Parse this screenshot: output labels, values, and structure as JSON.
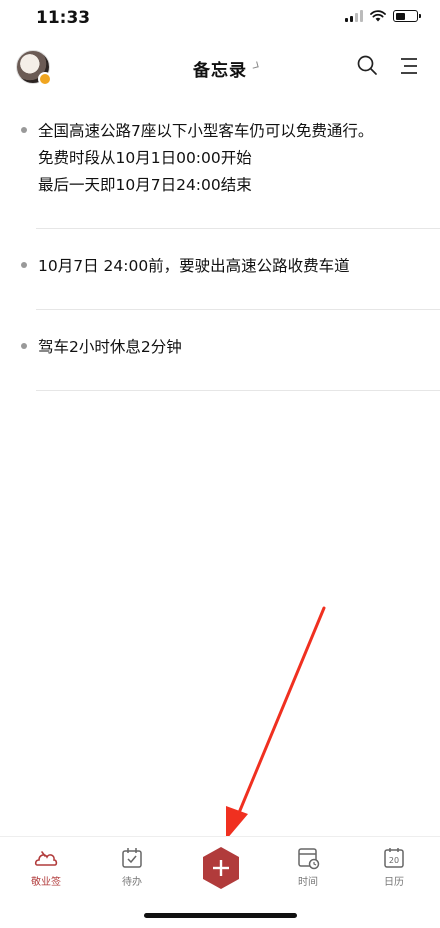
{
  "status_bar": {
    "time": "11:33"
  },
  "header": {
    "title": "备忘录"
  },
  "memos": [
    {
      "lines": [
        "全国高速公路7座以下小型客车仍可以免费通行。",
        "免费时段从10月1日00:00开始",
        "最后一天即10月7日24:00结束"
      ]
    },
    {
      "lines": [
        "10月7日 24:00前，要驶出高速公路收费车道"
      ]
    },
    {
      "lines": [
        "驾车2小时休息2分钟"
      ]
    }
  ],
  "tab_bar": {
    "tabs": [
      {
        "label": "敬业签",
        "icon": "cloud-sign-icon",
        "active": true
      },
      {
        "label": "待办",
        "icon": "calendar-check-icon",
        "active": false
      },
      {
        "label": "",
        "icon": "add-icon",
        "active": false
      },
      {
        "label": "时间",
        "icon": "time-schedule-icon",
        "active": false
      },
      {
        "label": "日历",
        "icon": "calendar-icon",
        "active": false
      }
    ],
    "calendar_day": "20"
  },
  "colors": {
    "accent": "#b13b3b",
    "arrow": "#f03020"
  }
}
